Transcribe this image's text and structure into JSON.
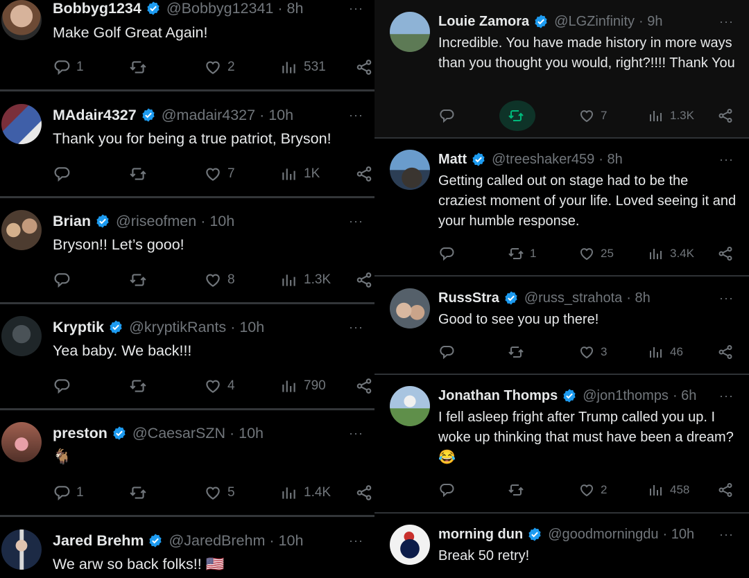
{
  "colors": {
    "accent": "#1d9bf0",
    "muted": "#71767b",
    "retweet_active": "#00ba7c"
  },
  "left_column": [
    {
      "name": "Bobbyg1234",
      "handle": "@Bobbyg12341",
      "time": "· 8h",
      "text": "Make Golf Great Again!",
      "replies": "1",
      "retweets": "",
      "likes": "2",
      "views": "531",
      "avatar_color": "#b07850"
    },
    {
      "name": "MAdair4327",
      "handle": "@madair4327",
      "time": "· 10h",
      "text": "Thank you for being a true patriot, Bryson!",
      "replies": "",
      "retweets": "",
      "likes": "7",
      "views": "1K",
      "avatar_color": "#4a5f8c"
    },
    {
      "name": "Brian",
      "handle": "@riseofmen",
      "time": "· 10h",
      "text": "Bryson!! Let’s gooo!",
      "replies": "",
      "retweets": "",
      "likes": "8",
      "views": "1.3K",
      "avatar_color": "#6e5a4a"
    },
    {
      "name": "Kryptik",
      "handle": "@kryptikRants",
      "time": "· 10h",
      "text": "Yea baby. We back!!!",
      "replies": "",
      "retweets": "",
      "likes": "4",
      "views": "790",
      "avatar_color": "#2a3236"
    },
    {
      "name": "preston",
      "handle": "@CaesarSZN",
      "time": "· 10h",
      "text": "🐐",
      "replies": "1",
      "retweets": "",
      "likes": "5",
      "views": "1.4K",
      "avatar_color": "#8a5a4c"
    },
    {
      "name": "Jared Brehm",
      "handle": "@JaredBrehm",
      "time": "· 10h",
      "text": "We arw so back folks!! 🇺🇸",
      "avatar_color": "#4a5566"
    }
  ],
  "right_column": [
    {
      "name": "Louie Zamora",
      "handle": "@LGZinfinity",
      "time": "· 9h",
      "text": "Incredible. You have made history in more ways than you thought you would, right?!!!! Thank You",
      "replies": "",
      "retweets": "",
      "likes": "7",
      "views": "1.3K",
      "avatar_color": "#5a7a9c"
    },
    {
      "name": "Matt",
      "handle": "@treeshaker459",
      "time": "· 8h",
      "text": "Getting called out on stage had to be the craziest moment of your life. Loved seeing it and your humble response.",
      "replies": "",
      "retweets": "1",
      "likes": "25",
      "views": "3.4K",
      "avatar_color": "#4e6a86"
    },
    {
      "name": "RussStra",
      "handle": "@russ_strahota",
      "time": "· 8h",
      "text": "Good to see you up there!",
      "replies": "",
      "retweets": "",
      "likes": "3",
      "views": "46",
      "avatar_color": "#7a8590"
    },
    {
      "name": "Jonathan Thomps",
      "handle": "@jon1thomps",
      "time": "· 6h",
      "text": "I fell asleep fright after Trump called you up. I woke up thinking that must have been a dream? 😂",
      "replies": "",
      "retweets": "",
      "likes": "2",
      "views": "458",
      "avatar_color": "#6d8f6a"
    },
    {
      "name": "morning dun",
      "handle": "@goodmorningdu",
      "time": "· 10h",
      "text": "Break 50 retry!",
      "avatar_color": "#e8e8e8"
    }
  ],
  "more_label": "···"
}
